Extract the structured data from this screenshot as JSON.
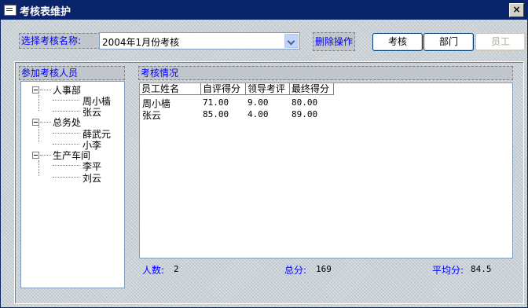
{
  "window": {
    "title": "考核表维护",
    "close": "×"
  },
  "toolbar": {
    "select_label": "选择考核名称:",
    "select_value": "2004年1月份考核",
    "delete_label": "删除操作",
    "buttons": [
      "考核",
      "部门",
      "员工"
    ]
  },
  "left_panel": {
    "header": "参加考核人员",
    "tree": [
      {
        "dept": "人事部",
        "members": [
          "周小樯",
          "张云"
        ]
      },
      {
        "dept": "总务处",
        "members": [
          "薛武元",
          "小李"
        ]
      },
      {
        "dept": "生产车间",
        "members": [
          "李平",
          "刘云"
        ]
      }
    ]
  },
  "right_panel": {
    "header": "考核情况",
    "columns": [
      "员工姓名",
      "自评得分",
      "领导考评",
      "最终得分"
    ],
    "rows": [
      [
        "周小樯",
        "71.00",
        "9.00",
        "80.00"
      ],
      [
        "张云",
        "85.00",
        "4.00",
        "89.00"
      ]
    ],
    "footer": {
      "count_label": "人数:",
      "count_value": "2",
      "total_label": "总分:",
      "total_value": "169",
      "avg_label": "平均分:",
      "avg_value": "84.5"
    }
  }
}
